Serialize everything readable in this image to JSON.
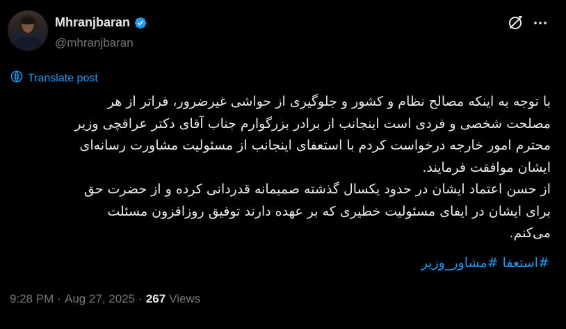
{
  "author": {
    "display_name": "Mhranjbaran",
    "handle": "@mhranjbaran",
    "verified": true
  },
  "translate_label": "Translate post",
  "tweet_lines": [
    "با توجه به اینکه مصالح نظام و کشور و جلوگیری از حواشی غیرضرور، فراتر از هر",
    "مصلحت شخصی و فردی است اینجانب از برادر بزرگوارم جناب آقای دکتر عراقچی وزیر",
    "محترم امور خارجه درخواست کردم با استعفای اینجانب از مسئولیت مشاورت رسانه‌ای",
    "ایشان موافقت فرمایند.",
    "از حسن اعتماد ایشان در حدود یکسال گذشته صمیمانه قدردانی کرده و از حضرت حق",
    "برای ایشان در ایفای مسئولیت خطیری که بر عهده دارند توفیق روزافزون مسئلت",
    "می‌کنم."
  ],
  "hashtags": [
    "#استعفا",
    "#مشاور_وزیر"
  ],
  "meta": {
    "time": "9:28 PM",
    "date": "Aug 27, 2025",
    "separator": "·",
    "views_count": "267",
    "views_label": "Views"
  },
  "icons": {
    "verified": "verified-badge-icon",
    "grok": "grok-icon",
    "more": "more-icon",
    "translate": "globe-icon"
  },
  "colors": {
    "background": "#000000",
    "text": "#e7e9ea",
    "secondary": "#71767b",
    "accent": "#1d9bf0"
  }
}
